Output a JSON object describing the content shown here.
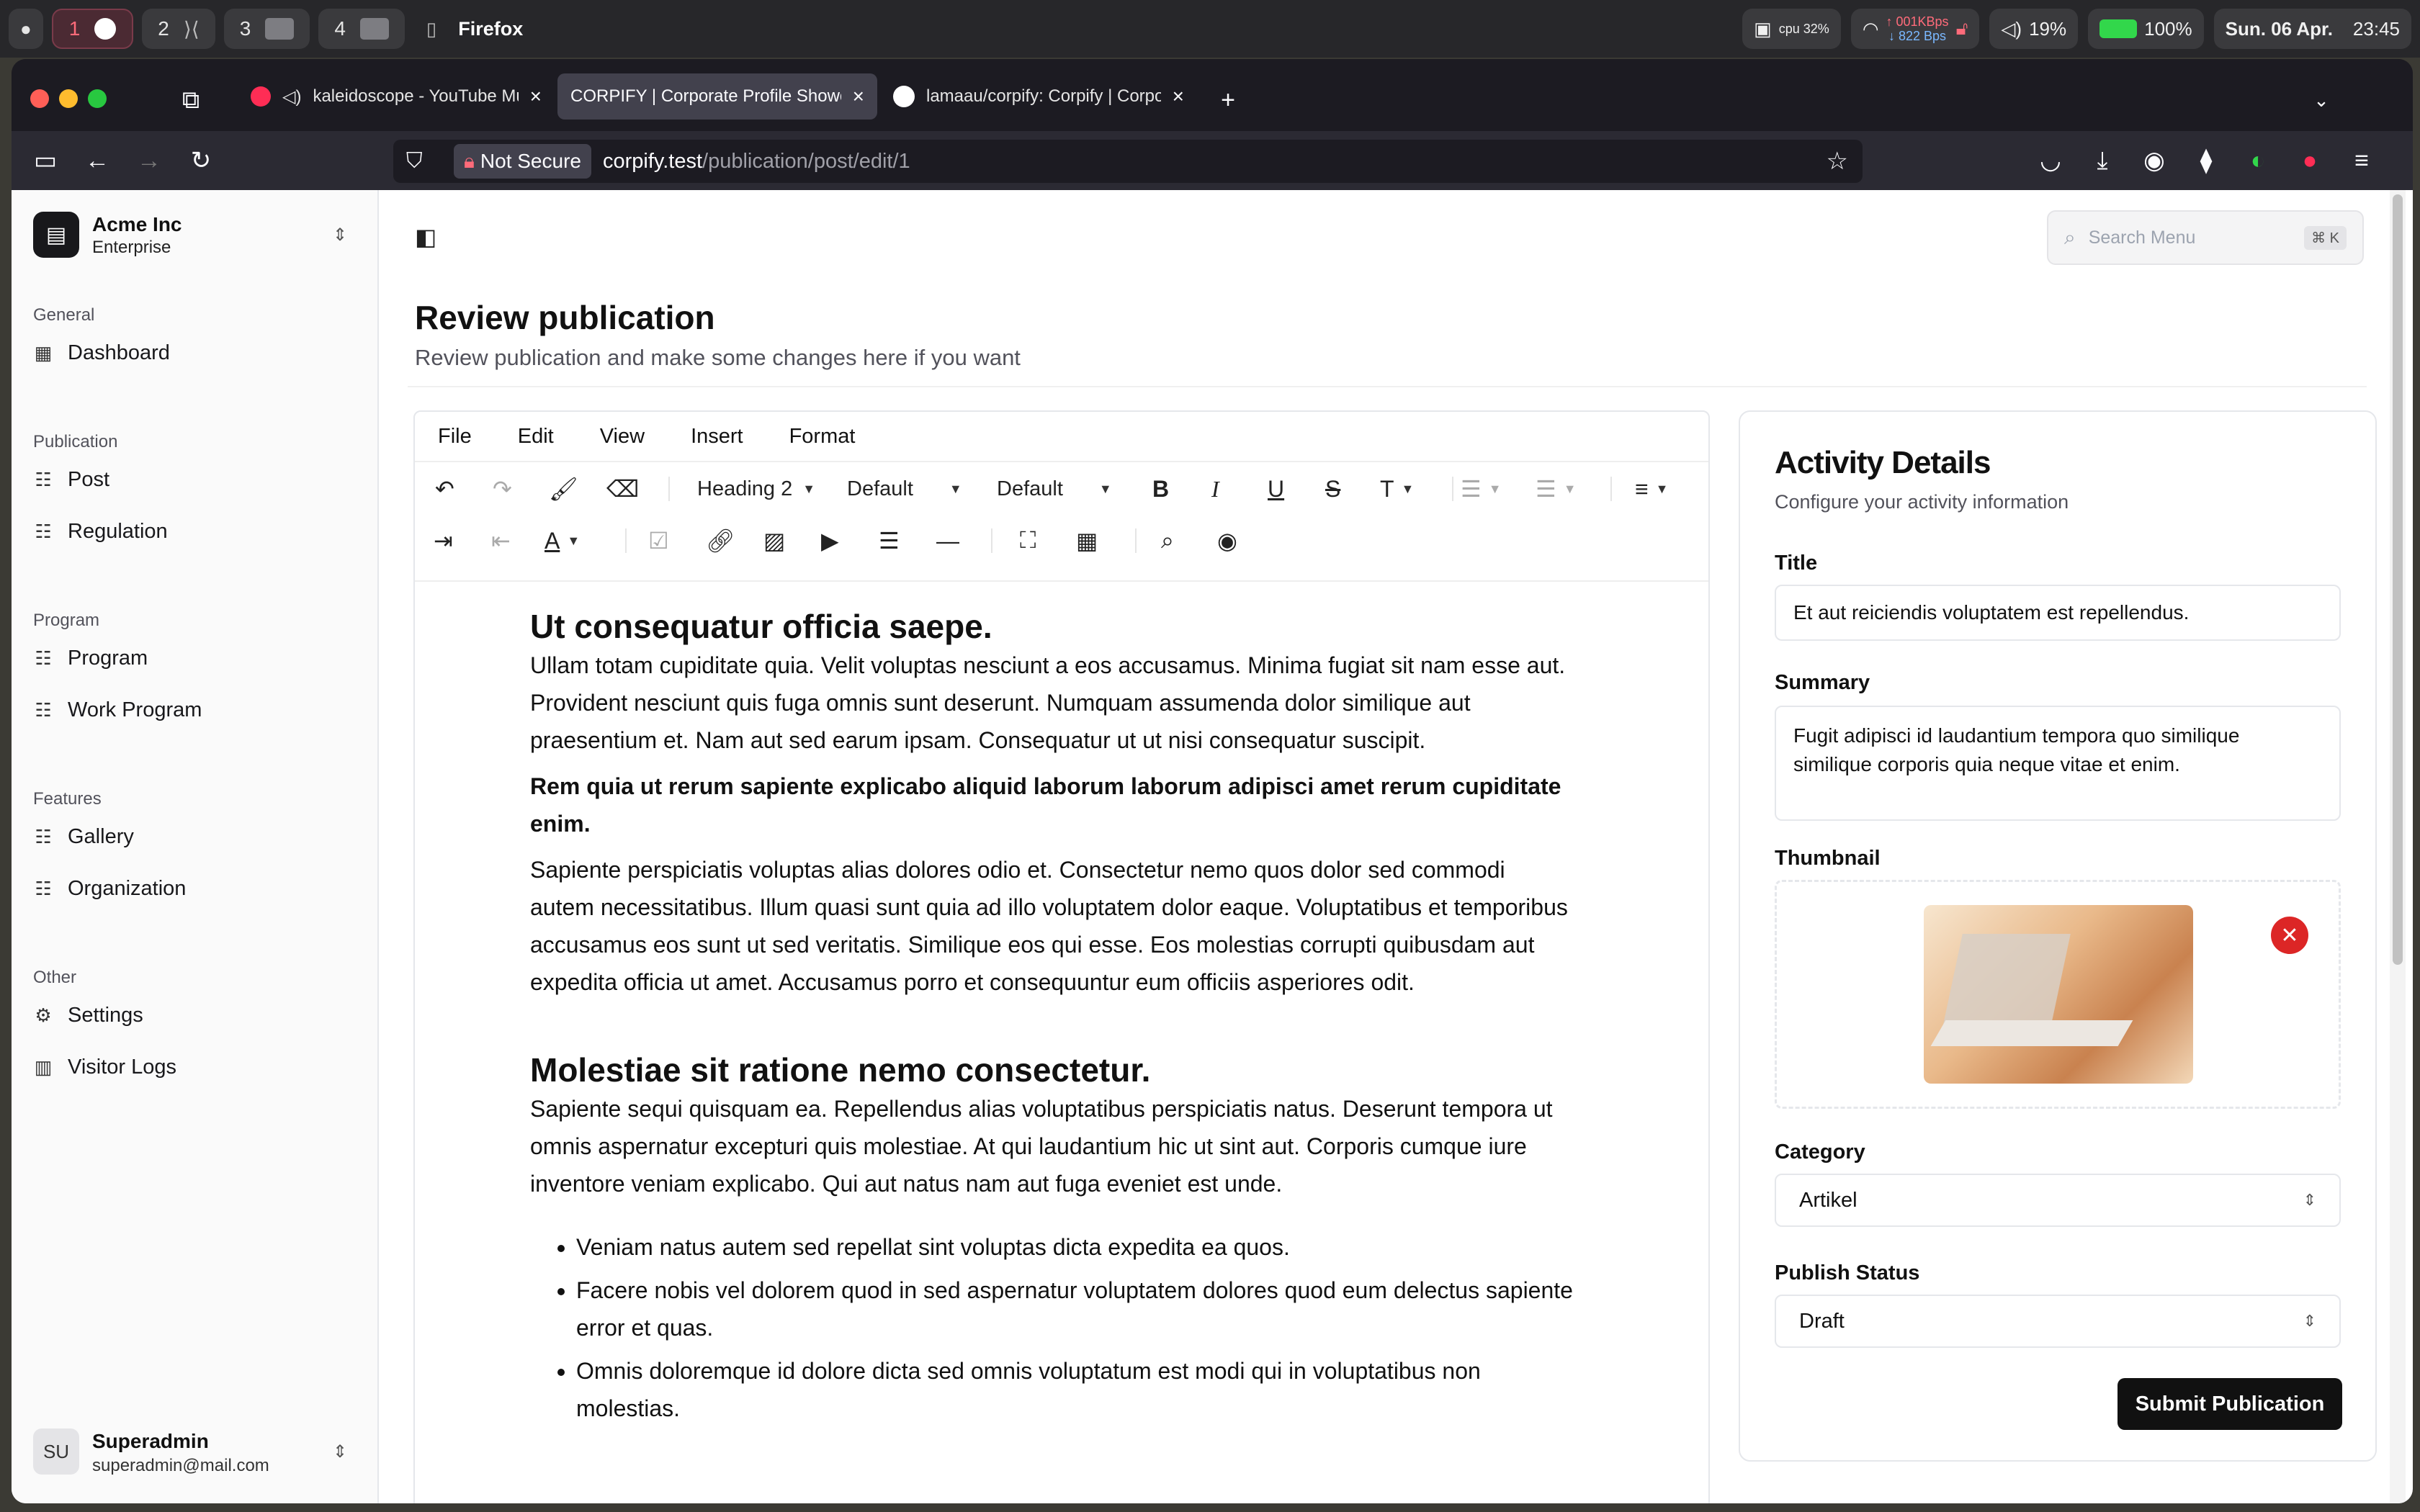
{
  "os_menubar": {
    "spaces": [
      {
        "num": "1",
        "icon": "firefox-icon"
      },
      {
        "num": "2",
        "icon": "vscode-icon"
      },
      {
        "num": "3",
        "icon": "window-icon"
      },
      {
        "num": "4",
        "icon": "window-icon"
      }
    ],
    "app_name": "Firefox",
    "cpu": "cpu 32%",
    "net_up": "↑ 001KBps",
    "net_down": "↓ 822 Bps",
    "volume": "19%",
    "battery": "100%",
    "date": "Sun. 06 Apr.",
    "time": "23:45"
  },
  "browser": {
    "tabs": [
      {
        "title": "kaleidoscope - YouTube Mu",
        "icon": "youtube-icon"
      },
      {
        "title": "CORPIFY | Corporate Profile Showca",
        "active": true
      },
      {
        "title": "lamaau/corpify: Corpify | Corpor",
        "icon": "github-icon"
      }
    ],
    "not_secure": "Not Secure",
    "url_host": "corpify.test",
    "url_path": "/publication/post/edit/1"
  },
  "sidebar": {
    "org_name": "Acme Inc",
    "org_plan": "Enterprise",
    "sections": [
      {
        "label": "General",
        "items": [
          "Dashboard"
        ]
      },
      {
        "label": "Publication",
        "items": [
          "Post",
          "Regulation"
        ]
      },
      {
        "label": "Program",
        "items": [
          "Program",
          "Work Program"
        ]
      },
      {
        "label": "Features",
        "items": [
          "Gallery",
          "Organization"
        ]
      },
      {
        "label": "Other",
        "items": [
          "Settings",
          "Visitor Logs"
        ]
      }
    ],
    "user": {
      "initials": "SU",
      "name": "Superadmin",
      "email": "superadmin@mail.com"
    }
  },
  "header": {
    "search_placeholder": "Search Menu",
    "search_shortcut": "⌘ K",
    "title": "Review publication",
    "subtitle": "Review publication and make some changes here if you want"
  },
  "editor": {
    "menu": [
      "File",
      "Edit",
      "View",
      "Insert",
      "Format"
    ],
    "block_format": "Heading 2",
    "font_family": "Default",
    "font_size": "Default",
    "content": {
      "h1": "Ut consequatur officia saepe.",
      "p1": "Ullam totam cupiditate quia. Velit voluptas nesciunt a eos accusamus. Minima fugiat sit nam esse aut. Provident nesciunt quis fuga omnis sunt deserunt. Numquam assumenda dolor similique aut praesentium et. Nam aut sed earum ipsam. Consequatur ut ut nisi consequatur suscipit.",
      "p2": "Rem quia ut rerum sapiente explicabo aliquid laborum laborum adipisci amet rerum cupiditate enim.",
      "p3": "Sapiente perspiciatis voluptas alias dolores odio et. Consectetur nemo quos dolor sed commodi autem necessitatibus. Illum quasi sunt quia ad illo voluptatem dolor eaque. Voluptatibus et temporibus accusamus eos sunt ut sed veritatis. Similique eos qui esse. Eos molestias corrupti quibusdam aut expedita officia ut amet. Accusamus porro et consequuntur eum officiis asperiores odit.",
      "h2": "Molestiae sit ratione nemo consectetur.",
      "p4": "Sapiente sequi quisquam ea. Repellendus alias voluptatibus perspiciatis natus. Deserunt tempora ut omnis aspernatur excepturi quis molestiae. At qui laudantium hic ut sint aut. Corporis cumque iure inventore veniam explicabo. Qui aut natus nam aut fuga eveniet est unde.",
      "list": [
        "Veniam natus autem sed repellat sint voluptas dicta expedita ea quos.",
        "Facere nobis vel dolorem quod in sed aspernatur voluptatem dolores quod eum delectus sapiente error et quas.",
        "Omnis doloremque id dolore dicta sed omnis voluptatum est modi qui in voluptatibus non molestias."
      ]
    }
  },
  "activity": {
    "title": "Activity Details",
    "subtitle": "Configure your activity information",
    "title_label": "Title",
    "title_value": "Et aut reiciendis voluptatem est repellendus.",
    "summary_label": "Summary",
    "summary_value": "Fugit adipisci id laudantium tempora quo similique similique corporis quia neque vitae et enim.",
    "thumbnail_label": "Thumbnail",
    "category_label": "Category",
    "category_value": "Artikel",
    "status_label": "Publish Status",
    "status_value": "Draft",
    "submit_label": "Submit Publication"
  }
}
